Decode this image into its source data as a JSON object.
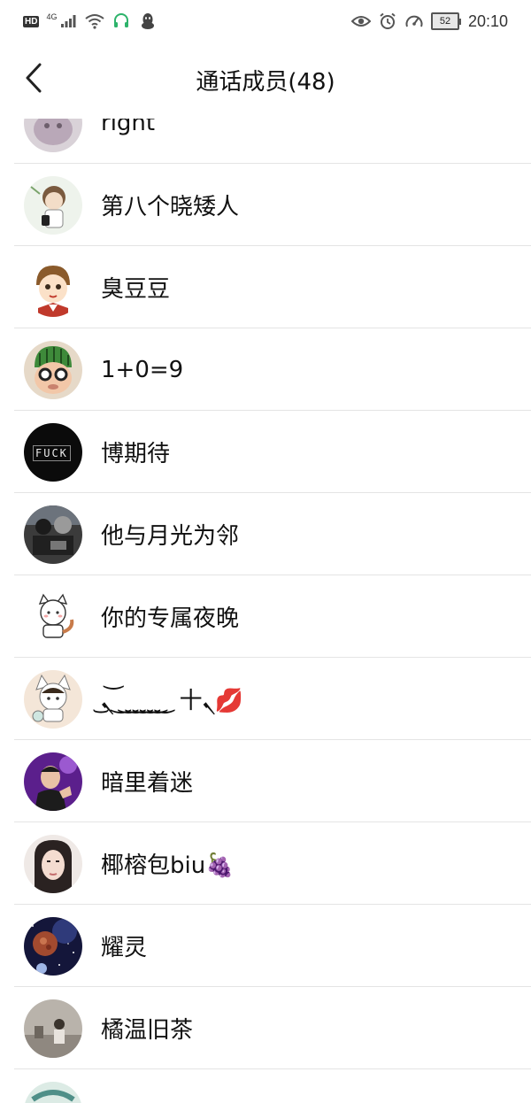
{
  "status_bar": {
    "hd": "HD",
    "network": "4G",
    "battery": "52",
    "time": "20:10"
  },
  "nav": {
    "title": "通话成员(48)"
  },
  "members": [
    {
      "name": "right"
    },
    {
      "name": "第八个晓矮人"
    },
    {
      "name": "臭豆豆"
    },
    {
      "name": "1+0=9"
    },
    {
      "name": "博期待",
      "avatar_text": "FUCK"
    },
    {
      "name": "他与月光为邻"
    },
    {
      "name": "你的专属夜晚"
    },
    {
      "name": "ܢ͜ ͝ ͜ ͜ ͜ ͜ ͜ ͜ ͜ 十ܢ💋"
    },
    {
      "name": "暗里着迷"
    },
    {
      "name": "椰榕包biu🍇"
    },
    {
      "name": "耀灵"
    },
    {
      "name": "橘温旧茶"
    },
    {
      "name": ""
    }
  ]
}
